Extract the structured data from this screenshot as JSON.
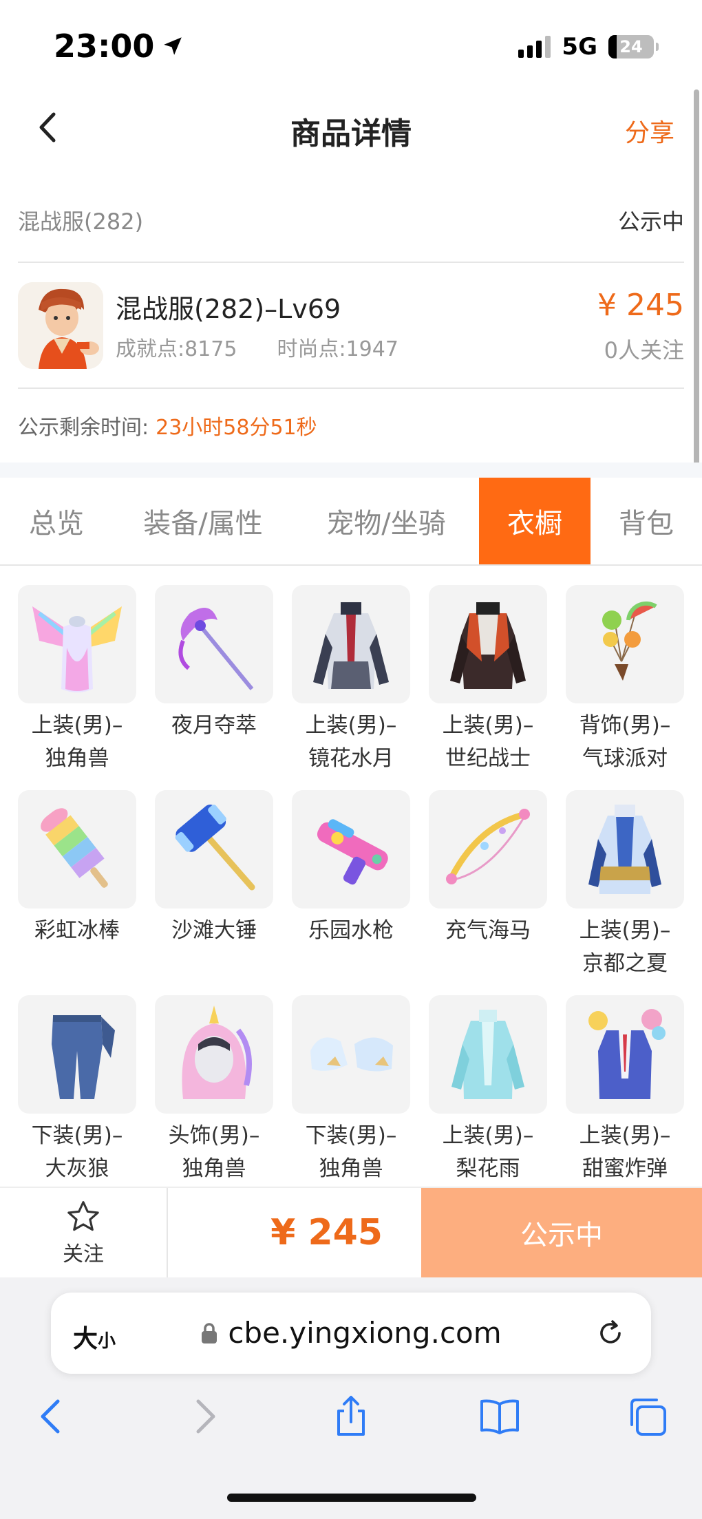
{
  "status_bar": {
    "time": "23:00",
    "network": "5G",
    "battery": "24"
  },
  "nav": {
    "title": "商品详情",
    "share_label": "分享"
  },
  "listing": {
    "server": "混战服(282)",
    "status": "公示中",
    "title": "混战服(282)–Lv69",
    "achievement": "成就点:8175",
    "fashion": "时尚点:1947",
    "price": "¥ 245",
    "followers": "0人关注",
    "remain_label": "公示剩余时间:",
    "remain_value": "23小时58分51秒"
  },
  "tabs": [
    {
      "label": "总览",
      "active": false
    },
    {
      "label": "装备/属性",
      "active": false
    },
    {
      "label": "宠物/坐骑",
      "active": false
    },
    {
      "label": "衣橱",
      "active": true
    },
    {
      "label": "背包",
      "active": false
    }
  ],
  "wardrobe": [
    {
      "line1": "上装(男)–",
      "line2": "独角兽",
      "icon": "unicorn-top-icon"
    },
    {
      "line1": "夜月夺萃",
      "line2": "",
      "icon": "scythe-icon"
    },
    {
      "line1": "上装(男)–",
      "line2": "镜花水月",
      "icon": "armor-top-icon"
    },
    {
      "line1": "上装(男)–",
      "line2": "世纪战士",
      "icon": "warrior-top-icon"
    },
    {
      "line1": "背饰(男)–",
      "line2": "气球派对",
      "icon": "balloon-icon"
    },
    {
      "line1": "彩虹冰棒",
      "line2": "",
      "icon": "popsicle-icon"
    },
    {
      "line1": "沙滩大锤",
      "line2": "",
      "icon": "hammer-icon"
    },
    {
      "line1": "乐园水枪",
      "line2": "",
      "icon": "water-gun-icon"
    },
    {
      "line1": "充气海马",
      "line2": "",
      "icon": "seahorse-bow-icon"
    },
    {
      "line1": "上装(男)–",
      "line2": "京都之夏",
      "icon": "kyoto-top-icon"
    },
    {
      "line1": "下装(男)–",
      "line2": "大灰狼",
      "icon": "wolf-pants-icon"
    },
    {
      "line1": "头饰(男)–",
      "line2": "独角兽",
      "icon": "unicorn-hood-icon"
    },
    {
      "line1": "下装(男)–",
      "line2": "独角兽",
      "icon": "unicorn-shoes-icon"
    },
    {
      "line1": "上装(男)–",
      "line2": "梨花雨",
      "icon": "pear-rain-top-icon"
    },
    {
      "line1": "上装(男)–",
      "line2": "甜蜜炸弹",
      "icon": "sweet-bomb-top-icon"
    }
  ],
  "action_bar": {
    "follow_label": "关注",
    "price": "¥ 245",
    "status": "公示中"
  },
  "browser": {
    "text_size": "大",
    "text_size_small": "小",
    "url": "cbe.yingxiong.com"
  },
  "colors": {
    "accent": "#ff6a13",
    "price": "#ee6a1a",
    "status_button": "#fdae7f",
    "ios_blue": "#2f7cf6"
  }
}
